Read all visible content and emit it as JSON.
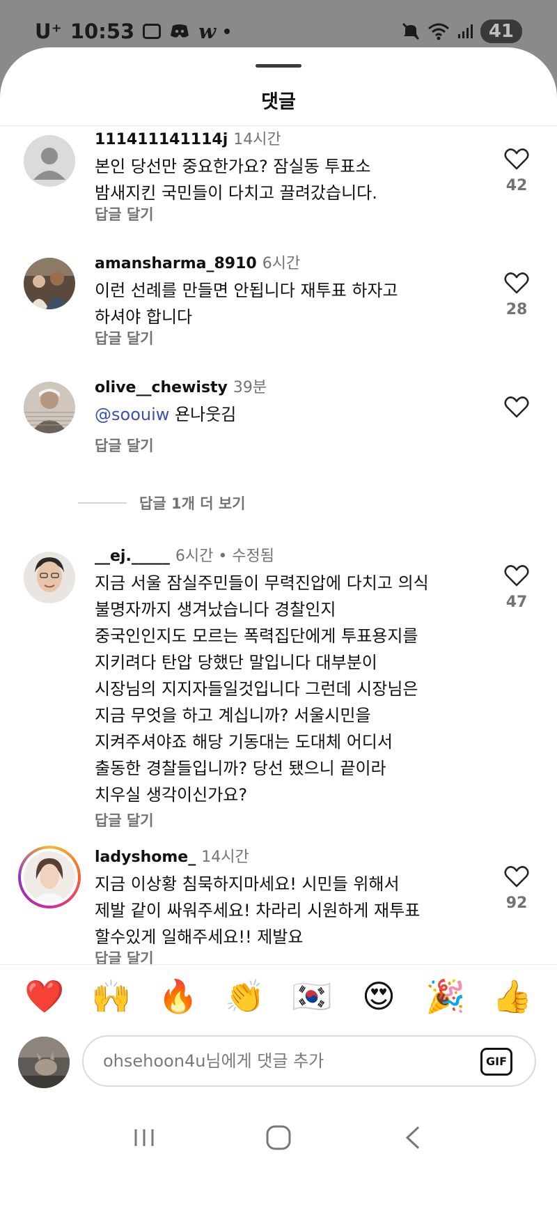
{
  "status_bar": {
    "carrier": "U⁺",
    "time": "10:53",
    "app_w": "w",
    "battery": "41"
  },
  "sheet": {
    "title": "댓글"
  },
  "comments": [
    {
      "username": "111411141114j",
      "time": "14시간",
      "text": "본인 당선만 중요한가요? 잠실동 투표소\n밤새지킨 국민들이 다치고 끌려갔습니다.",
      "reply_label": "답글 달기",
      "likes": "42"
    },
    {
      "username": "amansharma_8910",
      "time": "6시간",
      "text": "이런 선례를 만들면 안됩니다 재투표 하자고\n하셔야 합니다",
      "reply_label": "답글 달기",
      "likes": "28"
    },
    {
      "username": "olive__chewisty",
      "time": "39분",
      "mention": "@soouiw",
      "text": "욘나웃김",
      "reply_label": "답글 달기",
      "likes": ""
    },
    {
      "username": "__ej._____",
      "time": "6시간",
      "edited": "• 수정됨",
      "text": "지금 서울 잠실주민들이 무력진압에 다치고 의식\n불명자까지 생겨났습니다 경찰인지\n중국인인지도 모르는 폭력집단에게 투표용지를\n지키려다 탄압 당했단 말입니다 대부분이\n시장님의 지지자들일것입니다 그런데 시장님은\n지금 무엇을 하고 계십니까? 서울시민을\n지켜주셔야죠 해당 기동대는 도대체 어디서\n출동한 경찰들입니까? 당선 됐으니 끝이라\n치우실 생각이신가요?",
      "reply_label": "답글 달기",
      "likes": "47"
    },
    {
      "username": "ladyshome_",
      "time": "14시간",
      "text": "지금 이상황 침묵하지마세요! 시민들 위해서\n제발 같이 싸워주세요! 차라리 시원하게 재투표\n할수있게 일해주세요!! 제발요",
      "reply_label": "답글 달기",
      "likes": "92"
    }
  ],
  "more_replies": "답글 1개 더 보기",
  "emoji_bar": [
    "❤️",
    "🙌",
    "🔥",
    "👏",
    "🇰🇷",
    "😍",
    "🎉",
    "👍"
  ],
  "input": {
    "placeholder": "ohsehoon4u님에게 댓글 추가",
    "gif_label": "GIF"
  }
}
